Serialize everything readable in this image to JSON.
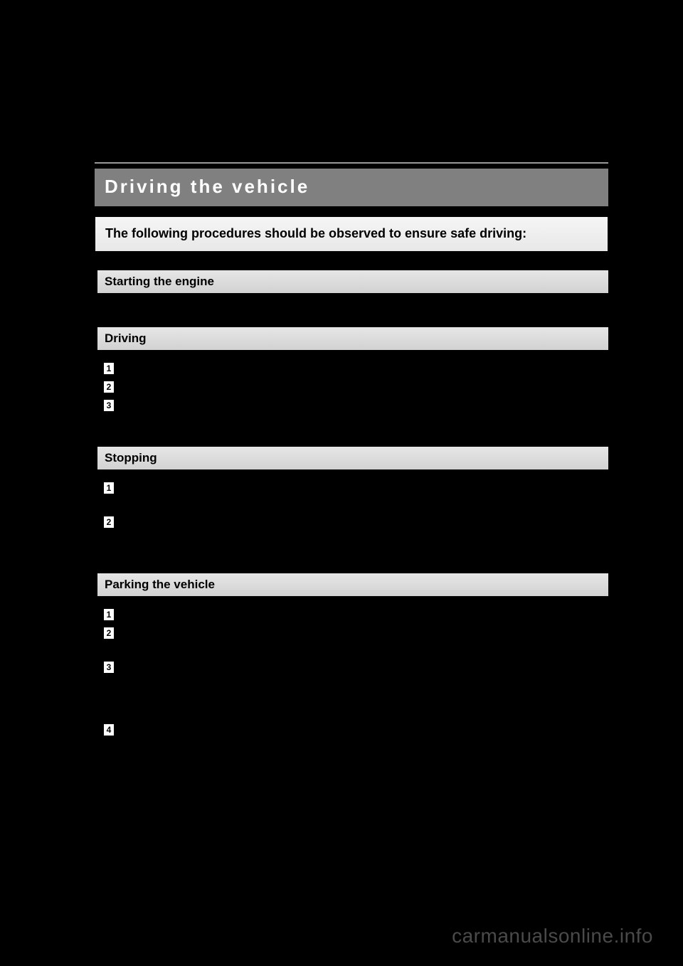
{
  "title": "Driving the vehicle",
  "intro": "The following procedures should be observed to ensure safe driving:",
  "sections": [
    {
      "heading": "Starting the engine",
      "body_text": "",
      "steps": []
    },
    {
      "heading": "Driving",
      "body_text": "",
      "steps": [
        {
          "num": "1",
          "text": ""
        },
        {
          "num": "2",
          "text": ""
        },
        {
          "num": "3",
          "text": ""
        }
      ]
    },
    {
      "heading": "Stopping",
      "body_text": "",
      "steps": [
        {
          "num": "1",
          "text": ""
        },
        {
          "num": "2",
          "text": ""
        }
      ]
    },
    {
      "heading": "Parking the vehicle",
      "body_text": "",
      "steps": [
        {
          "num": "1",
          "text": ""
        },
        {
          "num": "2",
          "text": ""
        },
        {
          "num": "3",
          "text": ""
        },
        {
          "num": "4",
          "text": ""
        }
      ]
    }
  ],
  "watermark": "carmanualsonline.info"
}
